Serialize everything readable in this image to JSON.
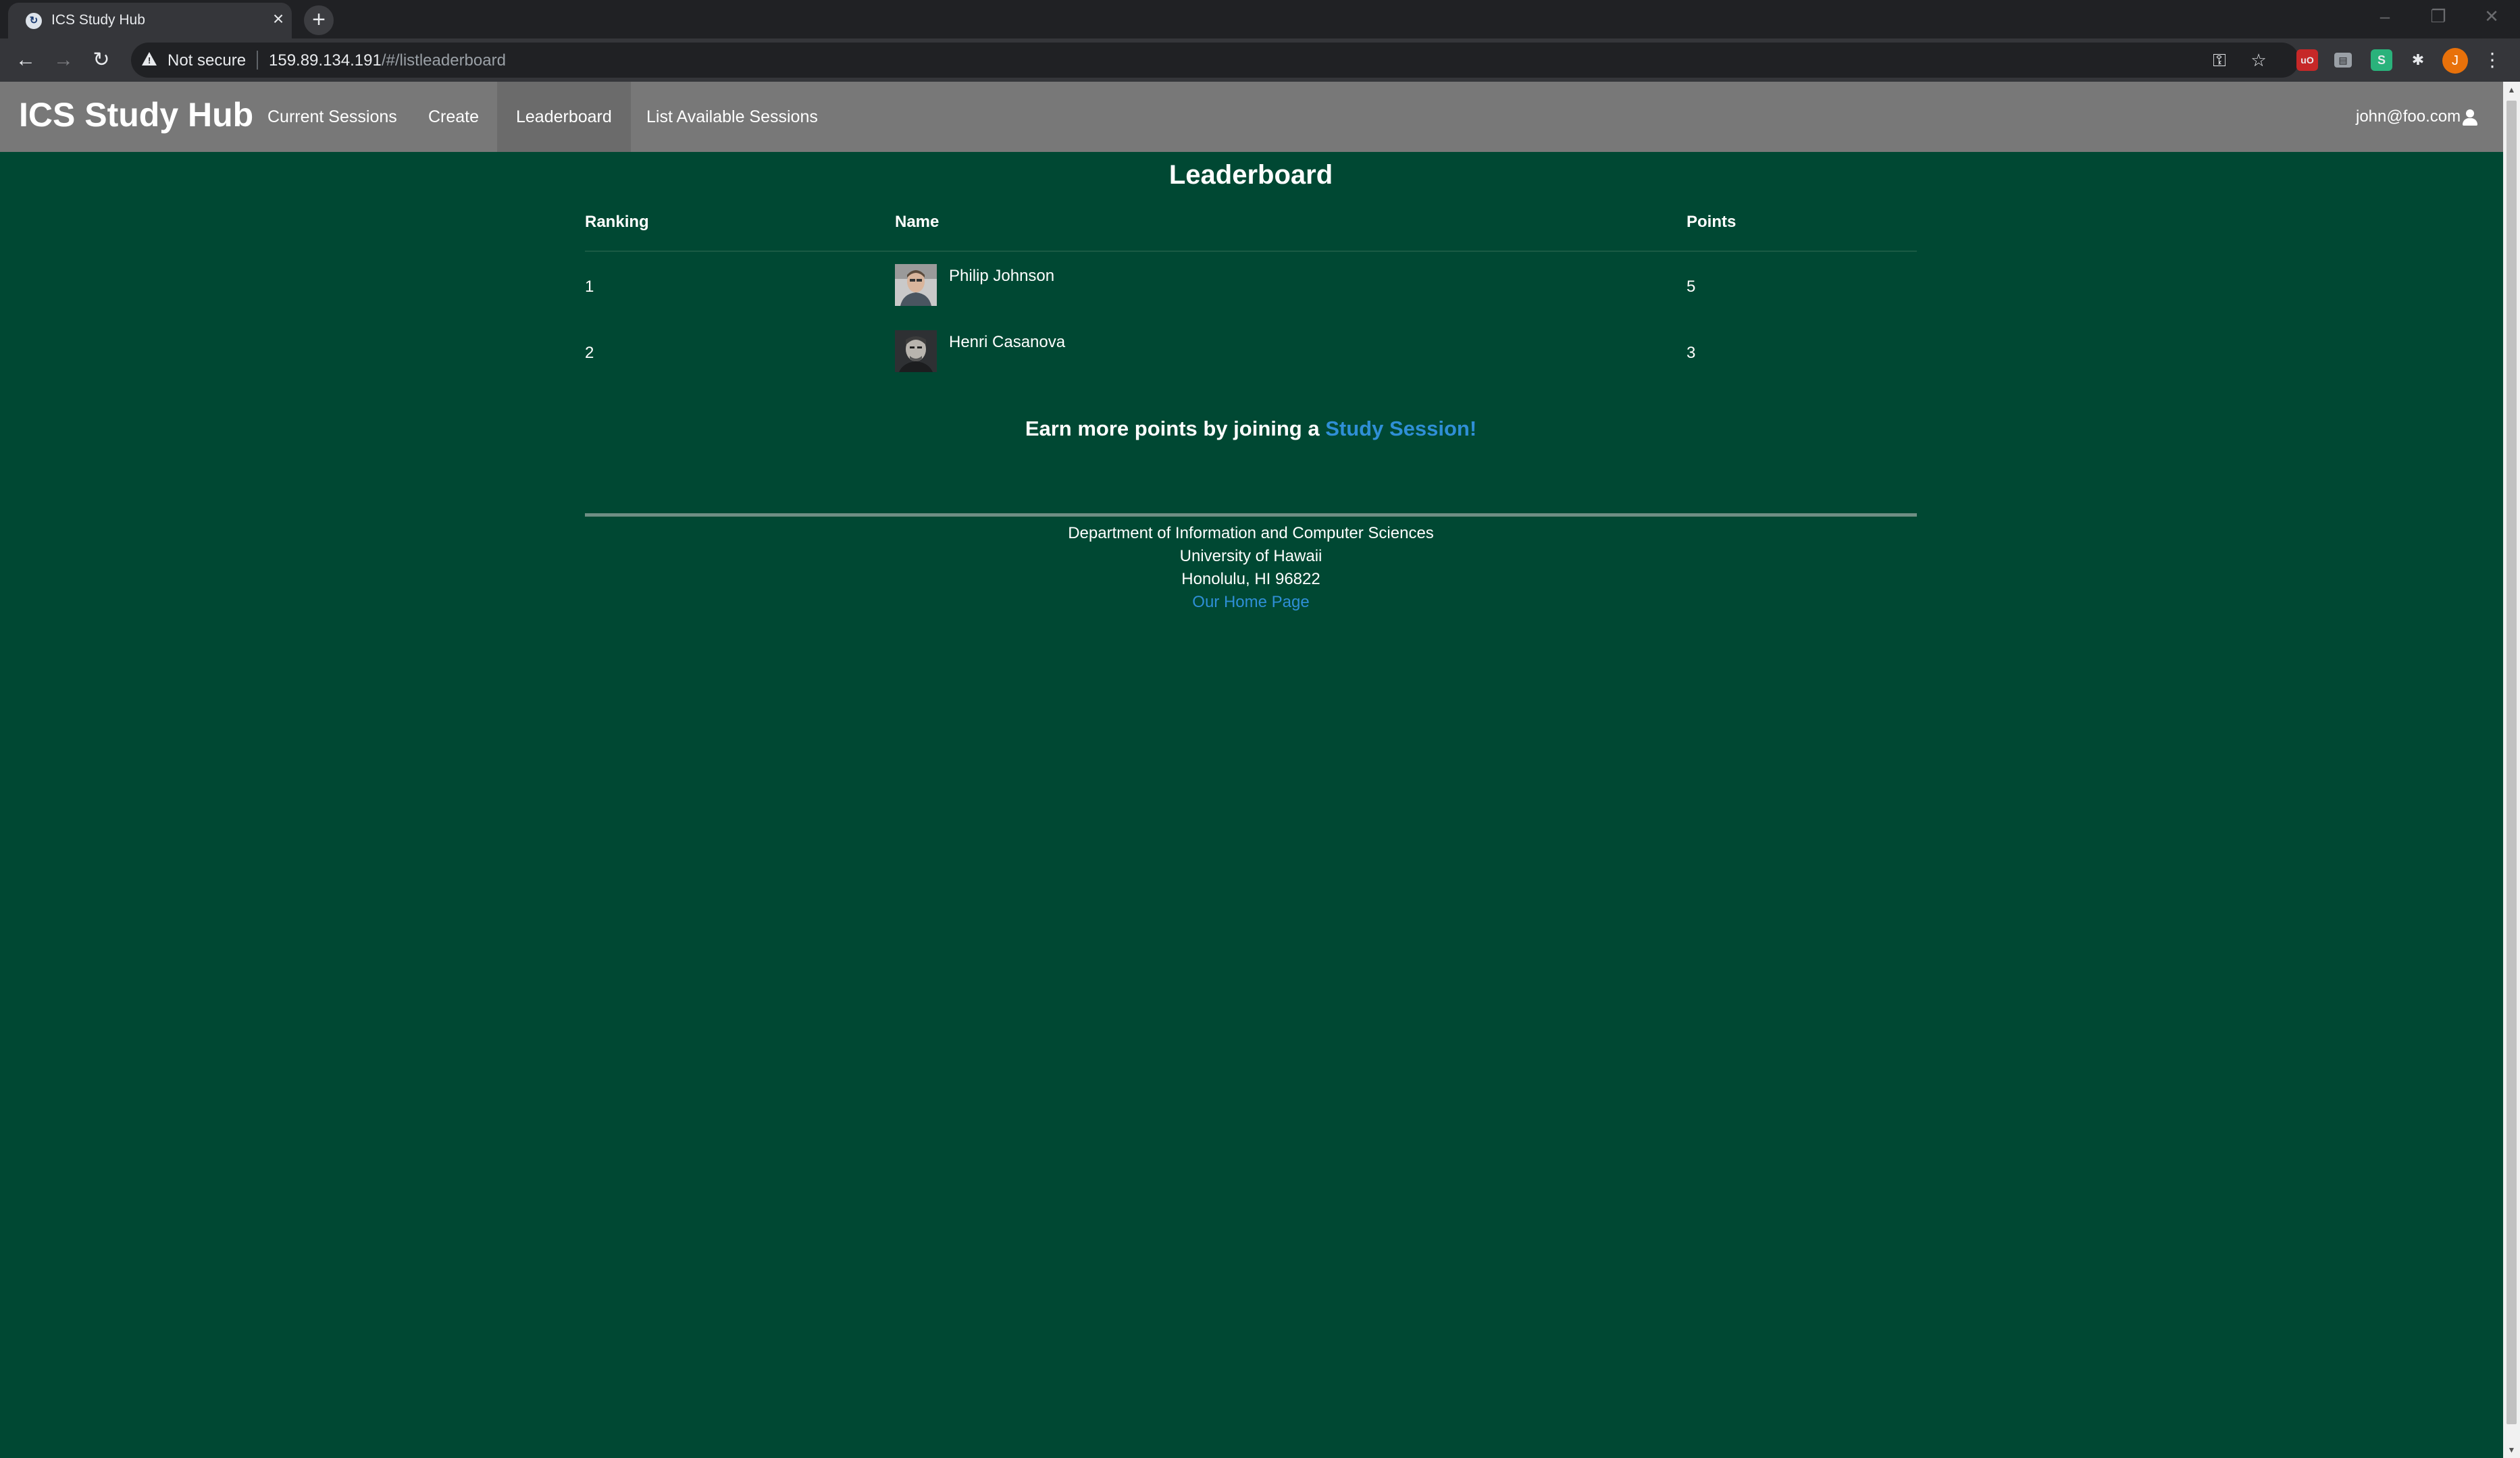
{
  "browser": {
    "tab_title": "ICS Study Hub",
    "tab_close": "×",
    "new_tab": "+",
    "security_label": "Not secure",
    "url_host": "159.89.134.191",
    "url_path": "/#/listleaderboard",
    "profile_initial": "J",
    "window_controls": [
      "–",
      "❐",
      "✕"
    ]
  },
  "navbar": {
    "brand": "ICS Study Hub",
    "links": [
      "Current Sessions",
      "Create",
      "Leaderboard",
      "List Available Sessions"
    ],
    "active_link": "Leaderboard",
    "user": "john@foo.com"
  },
  "leaderboard": {
    "title": "Leaderboard",
    "columns": [
      "Ranking",
      "Name",
      "Points"
    ],
    "rows": [
      {
        "ranking": "1",
        "name": "Philip Johnson",
        "points": "5"
      },
      {
        "ranking": "2",
        "name": "Henri Casanova",
        "points": "3"
      }
    ]
  },
  "cta": {
    "text": "Earn more points by joining a ",
    "link": "Study Session!"
  },
  "footer": {
    "line1": "Department of Information and Computer Sciences",
    "line2": "University of Hawaii",
    "line3": "Honolulu, HI 96822",
    "link": "Our Home Page"
  },
  "colors": {
    "page_background": "#004833",
    "navbar_background": "#787878",
    "link": "#2f8fd6"
  }
}
